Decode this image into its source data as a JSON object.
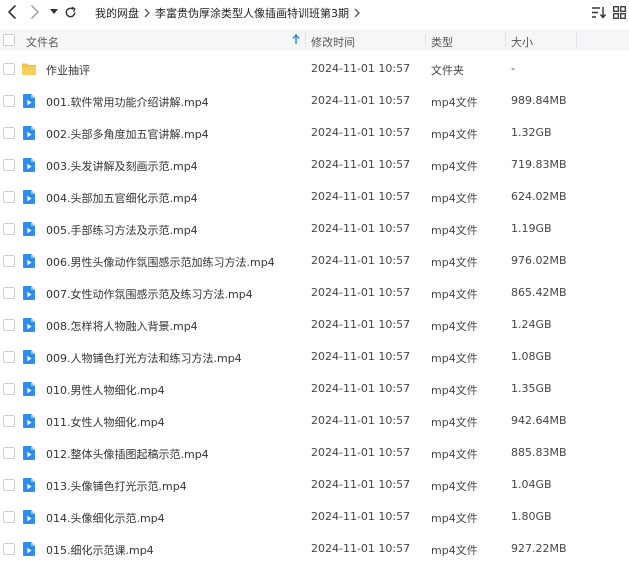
{
  "breadcrumb": {
    "items": [
      "我的网盘",
      "李富贵伪厚涂类型人像插画特训班第3期"
    ]
  },
  "columns": {
    "name": "文件名",
    "modified": "修改时间",
    "type": "类型",
    "size": "大小"
  },
  "colors": {
    "accent": "#2e8ef0",
    "folder": "#f7c342",
    "header_bg": "#f5f6f8"
  },
  "files": [
    {
      "name": "作业抽评",
      "modified": "2024-11-01 10:57",
      "type": "文件夹",
      "size": "-",
      "icon": "folder-icon"
    },
    {
      "name": "001.软件常用功能介绍讲解.mp4",
      "modified": "2024-11-01 10:57",
      "type": "mp4文件",
      "size": "989.84MB",
      "icon": "video-file-icon"
    },
    {
      "name": "002.头部多角度加五官讲解.mp4",
      "modified": "2024-11-01 10:57",
      "type": "mp4文件",
      "size": "1.32GB",
      "icon": "video-file-icon"
    },
    {
      "name": "003.头发讲解及刻画示范.mp4",
      "modified": "2024-11-01 10:57",
      "type": "mp4文件",
      "size": "719.83MB",
      "icon": "video-file-icon"
    },
    {
      "name": "004.头部加五官细化示范.mp4",
      "modified": "2024-11-01 10:57",
      "type": "mp4文件",
      "size": "624.02MB",
      "icon": "video-file-icon"
    },
    {
      "name": "005.手部练习方法及示范.mp4",
      "modified": "2024-11-01 10:57",
      "type": "mp4文件",
      "size": "1.19GB",
      "icon": "video-file-icon"
    },
    {
      "name": "006.男性头像动作氛围感示范加练习方法.mp4",
      "modified": "2024-11-01 10:57",
      "type": "mp4文件",
      "size": "976.02MB",
      "icon": "video-file-icon"
    },
    {
      "name": "007.女性动作氛围感示范及练习方法.mp4",
      "modified": "2024-11-01 10:57",
      "type": "mp4文件",
      "size": "865.42MB",
      "icon": "video-file-icon"
    },
    {
      "name": "008.怎样将人物融入背景.mp4",
      "modified": "2024-11-01 10:57",
      "type": "mp4文件",
      "size": "1.24GB",
      "icon": "video-file-icon"
    },
    {
      "name": "009.人物铺色打光方法和练习方法.mp4",
      "modified": "2024-11-01 10:57",
      "type": "mp4文件",
      "size": "1.08GB",
      "icon": "video-file-icon"
    },
    {
      "name": "010.男性人物细化.mp4",
      "modified": "2024-11-01 10:57",
      "type": "mp4文件",
      "size": "1.35GB",
      "icon": "video-file-icon"
    },
    {
      "name": "011.女性人物细化.mp4",
      "modified": "2024-11-01 10:57",
      "type": "mp4文件",
      "size": "942.64MB",
      "icon": "video-file-icon"
    },
    {
      "name": "012.整体头像插图起稿示范.mp4",
      "modified": "2024-11-01 10:57",
      "type": "mp4文件",
      "size": "885.83MB",
      "icon": "video-file-icon"
    },
    {
      "name": "013.头像铺色打光示范.mp4",
      "modified": "2024-11-01 10:57",
      "type": "mp4文件",
      "size": "1.04GB",
      "icon": "video-file-icon"
    },
    {
      "name": "014.头像细化示范.mp4",
      "modified": "2024-11-01 10:57",
      "type": "mp4文件",
      "size": "1.80GB",
      "icon": "video-file-icon"
    },
    {
      "name": "015.细化示范课.mp4",
      "modified": "2024-11-01 10:57",
      "type": "mp4文件",
      "size": "927.22MB",
      "icon": "video-file-icon"
    }
  ]
}
